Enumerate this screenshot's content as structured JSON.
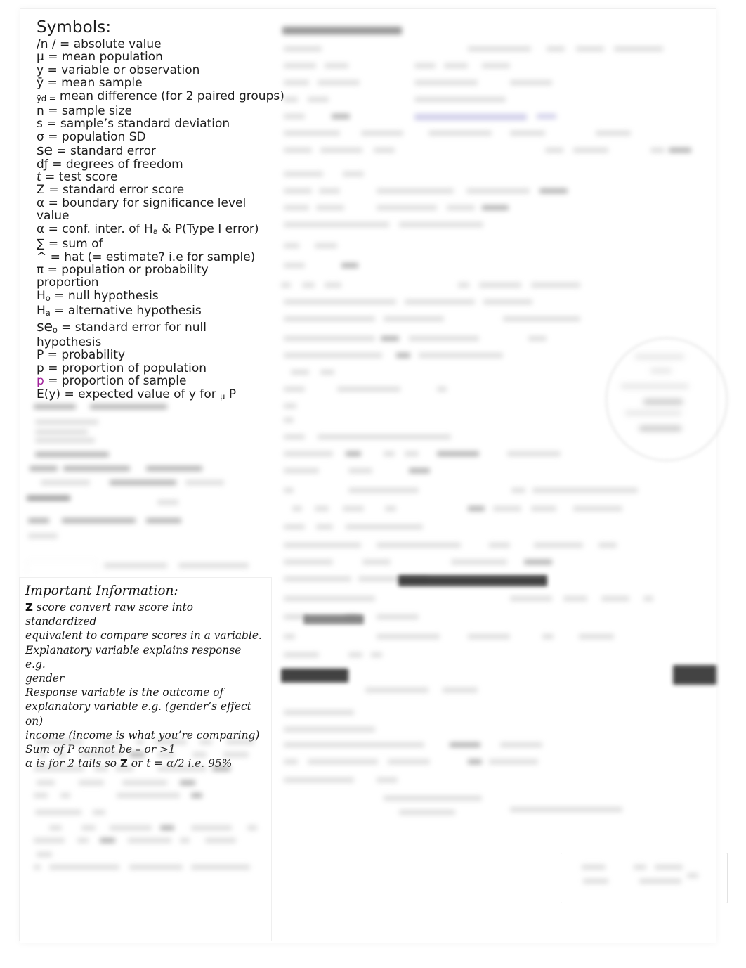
{
  "document": {
    "type": "scanned-study-notes-page",
    "page_background": "#ffffff",
    "frame_border_color": "#efefef",
    "accent_magenta": "#a0209a",
    "redaction_color": "#2a2a2a"
  },
  "left_column": {
    "symbols": {
      "heading": "Symbols:",
      "entries": [
        {
          "symbol": "/n /",
          "definition": "= absolute value",
          "style": "normal"
        },
        {
          "symbol": "μ",
          "definition": "= mean population",
          "style": "normal"
        },
        {
          "symbol": "y",
          "definition": "= variable or observation",
          "style": "normal"
        },
        {
          "symbol": "ȳ",
          "definition": "= mean sample",
          "style": "normal"
        },
        {
          "symbol": "ȳd =",
          "definition": "mean difference (for 2 paired groups)",
          "style": "subscript"
        },
        {
          "symbol": "n",
          "definition": "= sample size",
          "style": "normal"
        },
        {
          "symbol": "s",
          "definition": "= sample’s standard deviation",
          "style": "normal"
        },
        {
          "symbol": "σ",
          "definition": "= population SD",
          "style": "normal"
        },
        {
          "symbol": "se",
          "definition": "= standard error",
          "style": "large"
        },
        {
          "symbol": "dƒ",
          "definition": "= degrees of freedom",
          "style": "normal"
        },
        {
          "symbol": "t",
          "definition": "= test score",
          "style": "italic"
        },
        {
          "symbol": "Z",
          "definition": "= standard error score",
          "style": "normal"
        },
        {
          "symbol": "α",
          "definition": "= boundary for significance level value",
          "style": "wrap"
        },
        {
          "symbol": "α",
          "definition": "= conf. inter. of Ha & P(Type I error)",
          "style": "subscript"
        },
        {
          "symbol": "∑",
          "definition": "= sum of",
          "style": "normal"
        },
        {
          "symbol": "^",
          "definition": "= hat (= estimate? i.e for sample)",
          "style": "normal"
        },
        {
          "symbol": "π",
          "definition": "= population or probability proportion",
          "style": "wrap"
        },
        {
          "symbol": "Ho",
          "definition": "= null hypothesis",
          "style": "subscript"
        },
        {
          "symbol": "Ha",
          "definition": "= alternative hypothesis",
          "style": "subscript"
        },
        {
          "symbol": "seo",
          "definition": "= standard error for null hypothesis",
          "style": "large-wrap"
        },
        {
          "symbol": "P",
          "definition": "= probability",
          "style": "normal"
        },
        {
          "symbol": "p",
          "definition": "= proportion of population",
          "style": "normal"
        },
        {
          "symbol": "p",
          "definition": "= proportion of sample",
          "style": "magenta"
        },
        {
          "symbol": "E(y)",
          "definition": "= expected value of y for μ P",
          "style": "normal"
        }
      ]
    },
    "important_information": {
      "heading": "Important Information:",
      "lines": [
        "Z score convert raw score into standardized",
        "equivalent to compare scores in a variable.",
        "Explanatory variable explains response  e.g.",
        "gender",
        "Response variable is the outcome of",
        "explanatory variable   e.g. (gender’s effect on)",
        "income  (income is what you’re comparing)",
        "Sum of P cannot be – or >1",
        "α is for 2 tails so Z or t = α/2 i.e. 95%"
      ]
    },
    "blurred_note_regions": [
      {
        "name": "left-notes-upper",
        "legible": false
      },
      {
        "name": "left-notes-lower",
        "legible": false
      }
    ]
  },
  "right_column": {
    "legible": false,
    "description": "Out-of-focus scanned formula sheet column; text is not readable.",
    "regions": [
      {
        "name": "important-formulas-heading",
        "legible": false
      },
      {
        "name": "formula-body",
        "legible": false
      },
      {
        "name": "circle-annotation",
        "legible": false
      },
      {
        "name": "footer-box",
        "legible": false
      }
    ],
    "redactions": [
      {
        "name": "redaction-bar-1"
      },
      {
        "name": "redaction-bar-2"
      },
      {
        "name": "redaction-bar-3"
      },
      {
        "name": "redaction-bar-4"
      }
    ]
  }
}
